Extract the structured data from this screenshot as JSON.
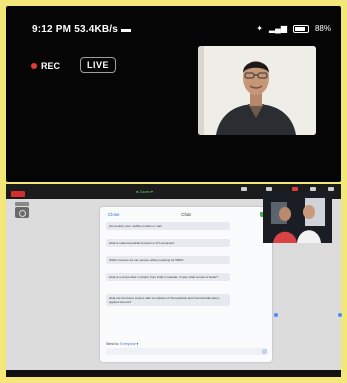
{
  "status_bar": {
    "time": "9:12 PM",
    "speed": "53.4KB/s",
    "battery": "88%"
  },
  "recording": {
    "rec_label": "REC",
    "live_label": "LIVE"
  },
  "toolbar": {
    "zoom_label": "Zoom"
  },
  "chat": {
    "close_label": "Close",
    "title": "Chat",
    "messages": [
      {
        "text": "pls mention your mobile number or mail"
      },
      {
        "text": "what is make beneficial invoices or P.G dynamics"
      },
      {
        "text": "Which courses we can pursue while preparing for PERC"
      },
      {
        "text": "what is a scope after m pharm from india in canada. I mean what course is better?"
      },
      {
        "text": "what are the future scopes after completion of biomaterials and chemical laboratory applied science?"
      }
    ],
    "send_to_prefix": "Send to:",
    "send_to_target": "Everyone"
  },
  "colors": {
    "frame": "#f3e77a",
    "accent": "#2d6fd6",
    "rec": "#e53935"
  }
}
